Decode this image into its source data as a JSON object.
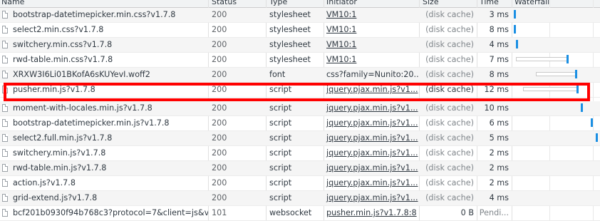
{
  "header": {
    "name": "Name",
    "status": "Status",
    "type": "Type",
    "initiator": "Initiator",
    "size": "Size",
    "time": "Time",
    "waterfall": "Waterfall"
  },
  "rows": [
    {
      "name": "bootstrap-datetimepicker.min.css?v1.7.8",
      "status": "200",
      "type": "stylesheet",
      "initiator": "VM10:1",
      "size": "(disk cache)",
      "time": "3 ms"
    },
    {
      "name": "select2.min.css?v1.7.8",
      "status": "200",
      "type": "stylesheet",
      "initiator": "VM10:1",
      "size": "(disk cache)",
      "time": "8 ms"
    },
    {
      "name": "switchery.min.css?v1.7.8",
      "status": "200",
      "type": "stylesheet",
      "initiator": "VM10:1",
      "size": "(disk cache)",
      "time": "4 ms"
    },
    {
      "name": "rwd-table.min.css?v1.7.8",
      "status": "200",
      "type": "stylesheet",
      "initiator": "VM10:1",
      "size": "(disk cache)",
      "time": "7 ms"
    },
    {
      "name": "XRXW3I6Li01BKofA6sKUYevI.woff2",
      "status": "200",
      "type": "font",
      "initiator": "css?family=Nunito:20...",
      "size": "(disk cache)",
      "time": "8 ms"
    },
    {
      "name": "pusher.min.js?v1.7.8",
      "status": "200",
      "type": "script",
      "initiator": "jquery.pjax.min.js?v1...",
      "size": "(disk cache)",
      "time": "12 ms"
    },
    {
      "name": "moment-with-locales.min.js?v1.7.8",
      "status": "200",
      "type": "script",
      "initiator": "jquery.pjax.min.js?v1...",
      "size": "(disk cache)",
      "time": "10 ms"
    },
    {
      "name": "bootstrap-datetimepicker.min.js?v1.7.8",
      "status": "200",
      "type": "script",
      "initiator": "jquery.pjax.min.js?v1...",
      "size": "(disk cache)",
      "time": "6 ms"
    },
    {
      "name": "select2.full.min.js?v1.7.8",
      "status": "200",
      "type": "script",
      "initiator": "jquery.pjax.min.js?v1...",
      "size": "(disk cache)",
      "time": "5 ms"
    },
    {
      "name": "switchery.min.js?v1.7.8",
      "status": "200",
      "type": "script",
      "initiator": "jquery.pjax.min.js?v1...",
      "size": "(disk cache)",
      "time": "2 ms"
    },
    {
      "name": "rwd-table.min.js?v1.7.8",
      "status": "200",
      "type": "script",
      "initiator": "jquery.pjax.min.js?v1...",
      "size": "(disk cache)",
      "time": "2 ms"
    },
    {
      "name": "action.js?v1.7.8",
      "status": "200",
      "type": "script",
      "initiator": "jquery.pjax.min.js?v1...",
      "size": "(disk cache)",
      "time": "2 ms"
    },
    {
      "name": "grid-extend.js?v1.7.8",
      "status": "200",
      "type": "script",
      "initiator": "jquery.pjax.min.js?v1...",
      "size": "(disk cache)",
      "time": "4 ms"
    },
    {
      "name": "bcf201b0930f94b768c3?protocol=7&client=js&v...",
      "status": "101",
      "type": "websocket",
      "initiator": "pusher.min.js?v1.7.8:8",
      "size": "0 B",
      "time": "Pendi..."
    }
  ],
  "highlighted_row": "pusher.min.js?v1.7.8",
  "colors": {
    "highlight_border": "#ff0000",
    "waterfall_receive": "#1a8fe3"
  },
  "icons": {
    "file": "file-icon"
  }
}
